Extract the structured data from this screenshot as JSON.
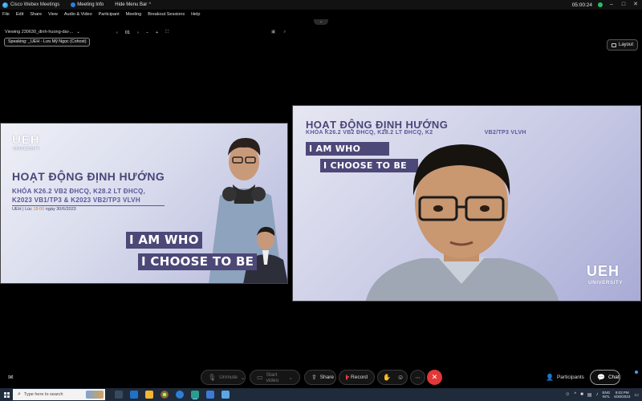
{
  "titlebar": {
    "app_name": "Cisco Webex Meetings",
    "meeting_info": "Meeting Info",
    "hide_menu": "Hide Menu Bar",
    "time": "05:00:24"
  },
  "menu": [
    "File",
    "Edit",
    "Share",
    "View",
    "Audio & Video",
    "Participant",
    "Meeting",
    "Breakout Sessions",
    "Help"
  ],
  "content_toolbar": {
    "viewing": "Viewing 230630_dinh-huong-dai-...",
    "page": "01"
  },
  "speaking": "Speaking: _UEH - Lưu Mỹ Ngọc (Cohost)",
  "layout_label": "Layout",
  "slide": {
    "logo": "UEH",
    "logo_sub": "UNIVERSITY",
    "title": "HOẠT ĐỘNG ĐỊNH HƯỚNG",
    "subtitle_line1": "KHÓA K26.2 VB2 ĐHCQ, K28.2 LT ĐHCQ,",
    "subtitle_line2": "K2023 VB1/TP3 & K2023 VB2/TP3 VLVH",
    "date_prefix": "UEH | Lúc",
    "date_time": "18:00",
    "date_suffix": "ngày 30/6/2023",
    "band1": "I AM WHO",
    "band2": "I CHOOSE TO BE"
  },
  "camera": {
    "title": "HOẠT ĐỘNG ĐỊNH HƯỚNG",
    "subtitle": "KHÓA K26.2 VB2 ĐHCQ, K28.2 LT ĐHCQ, K2",
    "subtitle_tail": "VB2/TP3 VLVH",
    "band1": "I AM WHO",
    "band2": "I CHOOSE TO BE",
    "logo": "UEH",
    "logo_sub": "UNIVERSITY"
  },
  "controls": {
    "unmute": "Unmute",
    "start_video": "Start video",
    "share": "Share",
    "record": "Record",
    "participants": "Participants",
    "chat": "Chat"
  },
  "taskbar": {
    "search_placeholder": "Type here to search",
    "lang_top": "ENG",
    "lang_bottom": "INTL",
    "time": "9:03 PM",
    "date": "6/30/2023"
  },
  "colors": {
    "slide_purple": "#4c4878",
    "record_red": "#e23838",
    "accent_orange": "#d7762d"
  }
}
